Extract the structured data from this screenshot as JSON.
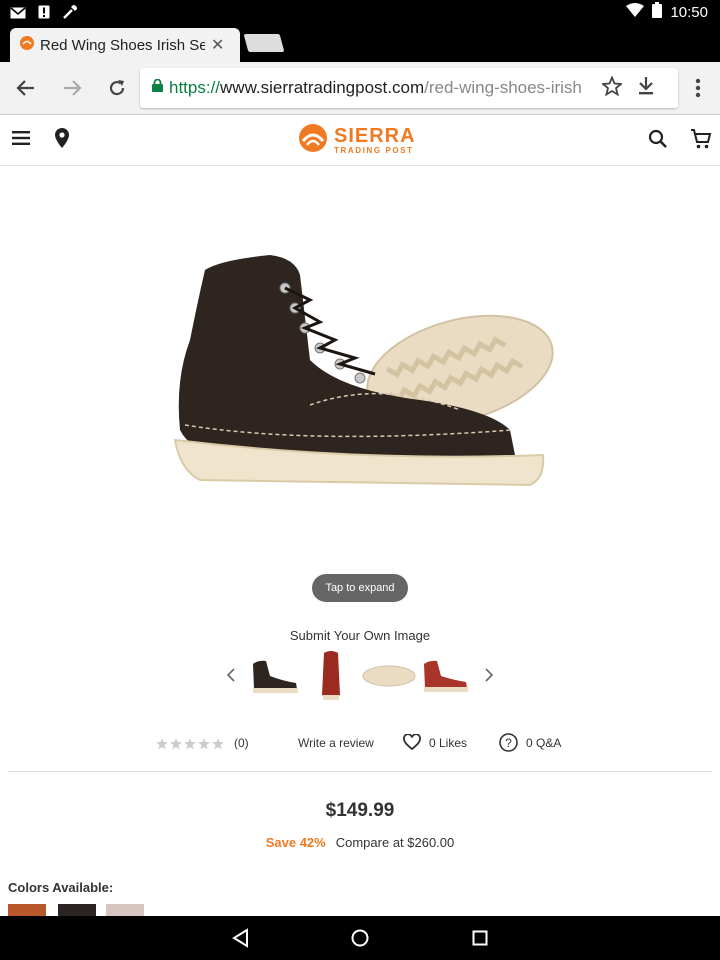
{
  "status_bar": {
    "time": "10:50"
  },
  "browser": {
    "tab_title": "Red Wing Shoes Irish Setter",
    "url_scheme": "https://",
    "url_host": "www.sierratradingpost.com",
    "url_path": "/red-wing-shoes-irish"
  },
  "site": {
    "brand": "SIERRA",
    "brand_sub": "TRADING POST",
    "brand_color": "#f07a22"
  },
  "product": {
    "expand_label": "Tap to expand",
    "submit_image_label": "Submit Your Own Image",
    "thumbnails": [
      "black-boot-side",
      "red-boot-front",
      "sole-view",
      "red-boot-side"
    ],
    "rating_count": "(0)",
    "write_review": "Write a review",
    "likes": "0 Likes",
    "qa": "0 Q&A",
    "price": "$149.99",
    "save": "Save 42%",
    "compare": "Compare at $260.00",
    "colors_label": "Colors Available:",
    "swatches": [
      "#b8582a",
      "#2a2422",
      "#d8c4c0"
    ]
  }
}
